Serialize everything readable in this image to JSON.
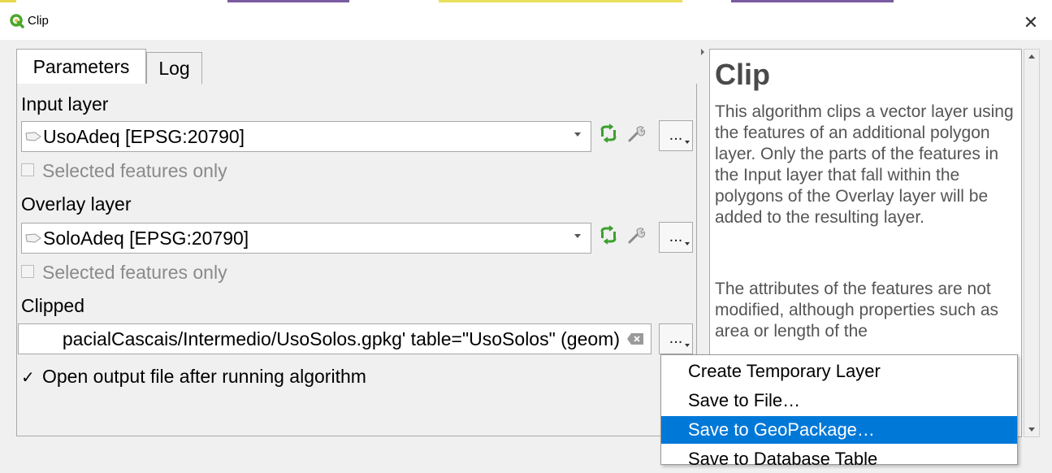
{
  "window": {
    "title": "Clip",
    "close_glyph": "✕"
  },
  "tabs": [
    {
      "label": "Parameters",
      "active": true
    },
    {
      "label": "Log",
      "active": false
    }
  ],
  "input_layer": {
    "label": "Input layer",
    "value": "UsoAdeq [EPSG:20790]",
    "selected_only": {
      "label": "Selected features only",
      "checked": false,
      "enabled": false
    },
    "more_button": "..."
  },
  "overlay_layer": {
    "label": "Overlay layer",
    "value": "SoloAdeq [EPSG:20790]",
    "selected_only": {
      "label": "Selected features only",
      "checked": false,
      "enabled": false
    },
    "more_button": "..."
  },
  "clipped": {
    "label": "Clipped",
    "value": "pacialCascais/Intermedio/UsoSolos.gpkg' table=\"UsoSolos\" (geom)",
    "more_button": "..."
  },
  "open_output": {
    "label": "Open output file after running algorithm",
    "checked": true,
    "check_glyph": "✓"
  },
  "help": {
    "title": "Clip",
    "paragraph1": "This algorithm clips a vector layer using the features of an additional polygon layer. Only the parts of the features in the Input layer that fall within the polygons of the Overlay layer will be added to the resulting layer.",
    "paragraph2": "The attributes of the features are not modified, although properties such as area or length of the"
  },
  "output_menu": {
    "items": [
      {
        "label": "Create Temporary Layer",
        "highlighted": false
      },
      {
        "label": "Save to File…",
        "highlighted": false
      },
      {
        "label": "Save to GeoPackage…",
        "highlighted": true
      },
      {
        "label": "Save to Database Table",
        "highlighted": false
      }
    ]
  },
  "colors": {
    "accent": "#0078d7",
    "qgis_green": "#4ca72d",
    "iterate_green": "#3aa02c"
  },
  "icons": [
    "qgis-logo-icon",
    "iterate-icon",
    "wrench-icon",
    "polygon-layer-icon",
    "clear-icon",
    "close-icon"
  ]
}
